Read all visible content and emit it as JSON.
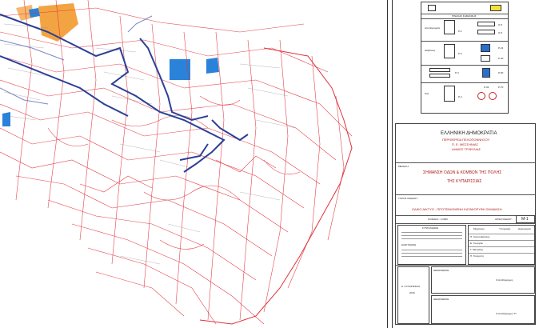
{
  "colors": {
    "road_red": "#e0303a",
    "route_blue": "#2b3f96",
    "zone_orange": "#f29a2e",
    "zone_blue": "#2a82d9",
    "frame": "#333333"
  },
  "legend": {
    "header": "ΠΙΝΑΚΑΣ ΣΗΜΑΝΣΗΣ",
    "rows": [
      {
        "code": "Ρ-1",
        "note": "Αποτελέσματα",
        "sign_code": "Ο-5"
      },
      {
        "code": "Ρ-2",
        "note": "Διαβάσεις",
        "sign_code": "Ρ-21"
      },
      {
        "code": "Ρ-3",
        "note": "Κατεύθυνση",
        "sign_code": "Ρ-40"
      },
      {
        "code": "Ρ-4",
        "note": "Ροή",
        "sign_code": "Ρ-50"
      }
    ],
    "right_codes": [
      "Ο-5",
      "Ο-5",
      "Ρ-21",
      "Ρ-40",
      "Ρ-50",
      "Ρ-32",
      "Ρ-70"
    ]
  },
  "title_block": {
    "authority_1": "ΕΛΛΗΝΙΚΗ ΔΗΜΟΚΡΑΤΙΑ",
    "authority_2": "ΠΕΡΙΦΕΡΕΙΑ ΠΕΛΟΠΟΝΝΗΣΟΥ",
    "authority_3": "Π. Ε. ΜΕΣΣΗΝΙΑΣ",
    "authority_4": "ΔΗΜΟΣ ΤΡΙΦΥΛΙΑΣ",
    "study_label": "ΜΕΛΕΤΗ:",
    "study_title_1": "ΣΗΜΑΝΣΗ ΟΔΩΝ & ΚΟΜΒΩΝ ΤΗΣ ΠΟΛΗΣ",
    "study_title_2": "ΤΗΣ ΚΥΠΑΡΙΣΣΙΑΣ",
    "drawing_label": "ΤΙΤΛΟΣ ΣΧΕΔΙΟΥ:",
    "drawing_title": "ΟΔΙΚΟ ΔΙΚΤΥΟ - ΠΡΟΤΕΙΝΟΜΕΝΗ ΚΑΤΑΚΟΡΥΦΗ ΣΗΜΑΝΣΗ",
    "scale_label": "ΚΛΙΜΑΚΑ : 1:2000",
    "sheet_label": "ΑΡΙΘ.ΣΧΕΔΙΟΥ:",
    "sheet_no": "Μ-1",
    "drafted_label": "ΣΥΝΤΑΧΘΗΚΕ",
    "checked_label": "ΕΛΕΓΧΘΗΚΕ",
    "col_headers": [
      "Μηχανικοί",
      "Υπογραφή",
      "Ημερομηνία"
    ],
    "engineers": [
      "Π. Κουτσοβασίλης",
      "Ε. Γεωργίου",
      "Γ. Μαυρίδης",
      "Π. Τσιριγώτη"
    ],
    "place": "Δ. ΚΥΠΑΡΙΣΣΙΑΣ",
    "year": "2016",
    "approval_label": "ΘΕΩΡΗΘΗΚΕ",
    "approval_sig": "Ο Αντιδήμαρχος",
    "approval_label_2": "ΘΕΩΡΗΘΗΚΕ",
    "approval_sig_2": "Ο Αντιδήμαρχος ΤΥ"
  }
}
